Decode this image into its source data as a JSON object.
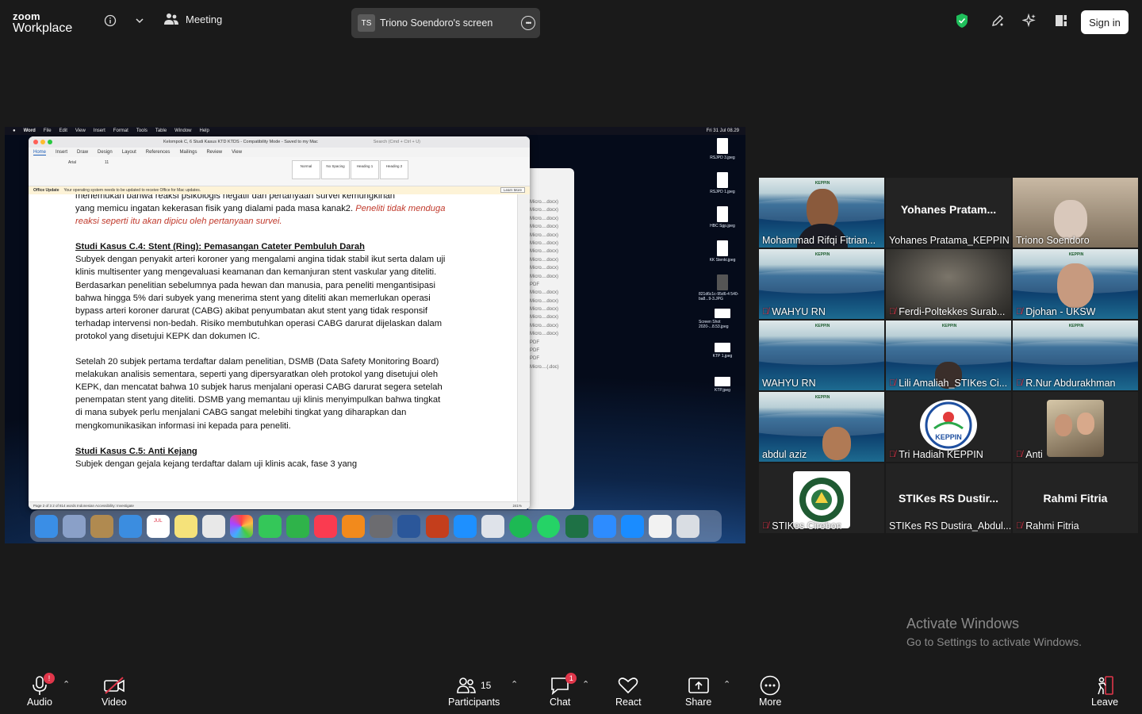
{
  "app": {
    "brand_top": "zoom",
    "brand_bottom": "Workplace"
  },
  "topbar": {
    "meeting_label": "Meeting",
    "share_badge": "TS",
    "share_title": "Triono Soendoro's screen",
    "signin_label": "Sign in"
  },
  "shared_screen": {
    "mac_menus": [
      "Word",
      "File",
      "Edit",
      "View",
      "Insert",
      "Format",
      "Tools",
      "Table",
      "Window",
      "Help"
    ],
    "mac_clock": "Fri 31 Jul 08.29",
    "word_title": "Kelompok C, 6 Studi Kasus KTD KTDS  -  Compatibility Mode  -  Saved to my Mac",
    "word_search": "Search (Cmd + Ctrl + U)",
    "word_tabs": [
      "Home",
      "Insert",
      "Draw",
      "Design",
      "Layout",
      "References",
      "Mailings",
      "Review",
      "View"
    ],
    "ribbon_styles": [
      "Normal",
      "No Spacing",
      "Heading 1",
      "Heading 2"
    ],
    "font_name": "Arial",
    "font_size": "11",
    "notice_label": "Office Update",
    "notice_text": "Your operating system needs to be updated to receive Office for Mac updates.",
    "notice_button": "Learn More",
    "status_text": "Page 2 of 3    2 of 814 words    Indonesian    Accessibility: Investigate",
    "zoom_pct": "241%",
    "doc": {
      "p1_line1": "menemukan bahwa reaksi psikologis negatif dari pertanyaan survei kemungkinan",
      "p1_line2": "yang memicu ingatan kekerasan fisik yang dialami pada masa kanak2. ",
      "p1_red": "Peneliti tidak menduga reaksi seperti itu akan dipicu oleh pertanyaan survei.",
      "h1": "Studi Kasus C.4: Stent (Ring): Pemasangan Cateter Pembuluh Darah",
      "p2": "Subyek dengan penyakit arteri koroner yang mengalami angina tidak stabil ikut serta dalam uji klinis multisenter yang mengevaluasi keamanan dan kemanjuran stent vaskular yang diteliti. Berdasarkan penelitian sebelumnya pada hewan dan manusia, para peneliti mengantisipasi bahwa hingga 5% dari subyek yang menerima stent yang diteliti akan memerlukan operasi bypass arteri koroner darurat (CABG) akibat penyumbatan akut stent yang tidak responsif terhadap intervensi non-bedah. Risiko membutuhkan operasi CABG darurat dijelaskan dalam protokol yang disetujui KEPK dan dokumen IC.",
      "p3": "Setelah 20 subjek pertama terdaftar dalam penelitian, DSMB (Data Safety Monitoring Board) melakukan analisis sementara, seperti yang dipersyaratkan oleh protokol yang disetujui oleh KEPK, dan mencatat bahwa 10 subjek harus menjalani operasi CABG darurat segera setelah penempatan stent yang diteliti. DSMB yang memantau uji klinis menyimpulkan bahwa tingkat di mana subyek perlu menjalani CABG sangat melebihi tingkat yang diharapkan dan mengkomunikasikan informasi ini kepada para peneliti.",
      "h2": "Studi Kasus C.5: Anti Kejang",
      "p4": "Subjek dengan gejala kejang terdaftar dalam uji klinis acak, fase 3 yang"
    },
    "finder_items": [
      "Micro....docx)",
      "Micro....docx)",
      "Micro....docx)",
      "Micro....docx)",
      "Micro....docx)",
      "Micro....docx)",
      "Micro....docx)",
      "Micro....docx)",
      "Micro....docx)",
      "Micro....docx)",
      "PDF",
      "Micro....docx)",
      "Micro....docx)",
      "Micro....docx)",
      "Micro....docx)",
      "Micro....docx)",
      "Micro....docx)",
      "PDF",
      "PDF",
      "PDF",
      "Micro....(.doc)"
    ],
    "desktop_files": [
      "RSJPD 3.jpeg",
      "RSJPD 1.jpeg",
      "HBC Sgp.jpeg",
      "KK Stenki.jpeg",
      "821d6c1c-95d6-4 540-ba8...9-3.JPG",
      "Screen Shot 2020-...8.53.jpeg",
      "KTP 1.jpeg",
      "KTP.jpeg"
    ],
    "dock_date_month": "JUL",
    "dock_date_day": "31"
  },
  "participants": [
    {
      "name": "Mohammad Rifqi Fitrian...",
      "muted": false,
      "speaking": true,
      "tile_big": ""
    },
    {
      "name": "Yohanes Pratama_KEPPIN",
      "muted": false,
      "speaking": false,
      "tile_big": "Yohanes  Pratam..."
    },
    {
      "name": "Triono Soendoro",
      "muted": false,
      "speaking": false,
      "tile_big": ""
    },
    {
      "name": "WAHYU RN",
      "muted": true,
      "speaking": false,
      "tile_big": ""
    },
    {
      "name": "Ferdi-Poltekkes Surab...",
      "muted": true,
      "speaking": false,
      "tile_big": ""
    },
    {
      "name": "Djohan - UKSW",
      "muted": true,
      "speaking": false,
      "tile_big": ""
    },
    {
      "name": "WAHYU RN",
      "muted": false,
      "speaking": false,
      "tile_big": ""
    },
    {
      "name": "Lili Amaliah_STIKes Ci...",
      "muted": true,
      "speaking": false,
      "tile_big": ""
    },
    {
      "name": "R.Nur Abdurakhman",
      "muted": true,
      "speaking": false,
      "tile_big": ""
    },
    {
      "name": "abdul aziz",
      "muted": false,
      "speaking": false,
      "tile_big": ""
    },
    {
      "name": "Tri Hadiah KEPPIN",
      "muted": true,
      "speaking": false,
      "tile_big": ""
    },
    {
      "name": "Anti",
      "muted": true,
      "speaking": false,
      "tile_big": ""
    },
    {
      "name": "STIKes Cirebon",
      "muted": true,
      "speaking": false,
      "tile_big": ""
    },
    {
      "name": "STIKes RS Dustira_Abdul...",
      "muted": false,
      "speaking": false,
      "tile_big": "STIKes RS Dustir..."
    },
    {
      "name": "Rahmi Fitria",
      "muted": true,
      "speaking": false,
      "tile_big": "Rahmi Fitria"
    }
  ],
  "keppin_logo_text": "KEPPIN",
  "watermark": {
    "line1": "Activate Windows",
    "line2": "Go to Settings to activate Windows."
  },
  "toolbar": {
    "audio": "Audio",
    "audio_badge": "!",
    "video": "Video",
    "participants": "Participants",
    "participants_count": "15",
    "chat": "Chat",
    "chat_badge": "1",
    "react": "React",
    "share": "Share",
    "more": "More",
    "leave": "Leave"
  },
  "colors": {
    "speaking_outline": "#25c28f",
    "mute_red": "#e0364a",
    "shield_green": "#1fbf5b"
  }
}
